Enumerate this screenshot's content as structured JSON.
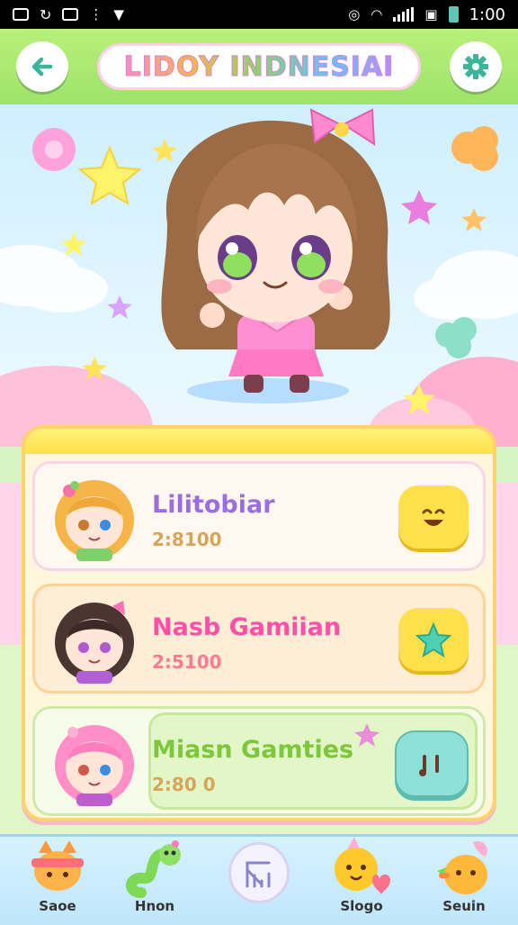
{
  "status": {
    "time": "1:00"
  },
  "header": {
    "title": "LIDOY INDNESIAI"
  },
  "list": [
    {
      "name": "Lilitobiar",
      "score": "2:8100",
      "name_color": "#9a6ee0",
      "button": "smile-face-icon"
    },
    {
      "name": "Nasb Gamiian",
      "score": "2:5100",
      "name_color": "#ff4fa8",
      "button": "star-icon"
    },
    {
      "name": "Miasn Gamties",
      "score": "2:80 0",
      "name_color": "#7cc83a",
      "button": "music-notes-icon"
    }
  ],
  "nav": [
    {
      "label": "Saoe"
    },
    {
      "label": "Hnon"
    },
    {
      "label": ""
    },
    {
      "label": "Slogo"
    },
    {
      "label": "Seuin"
    }
  ],
  "colors": {
    "header": "#a8e874",
    "panel_border": "#ffd36b",
    "accent_pink": "#ff7ec4"
  }
}
